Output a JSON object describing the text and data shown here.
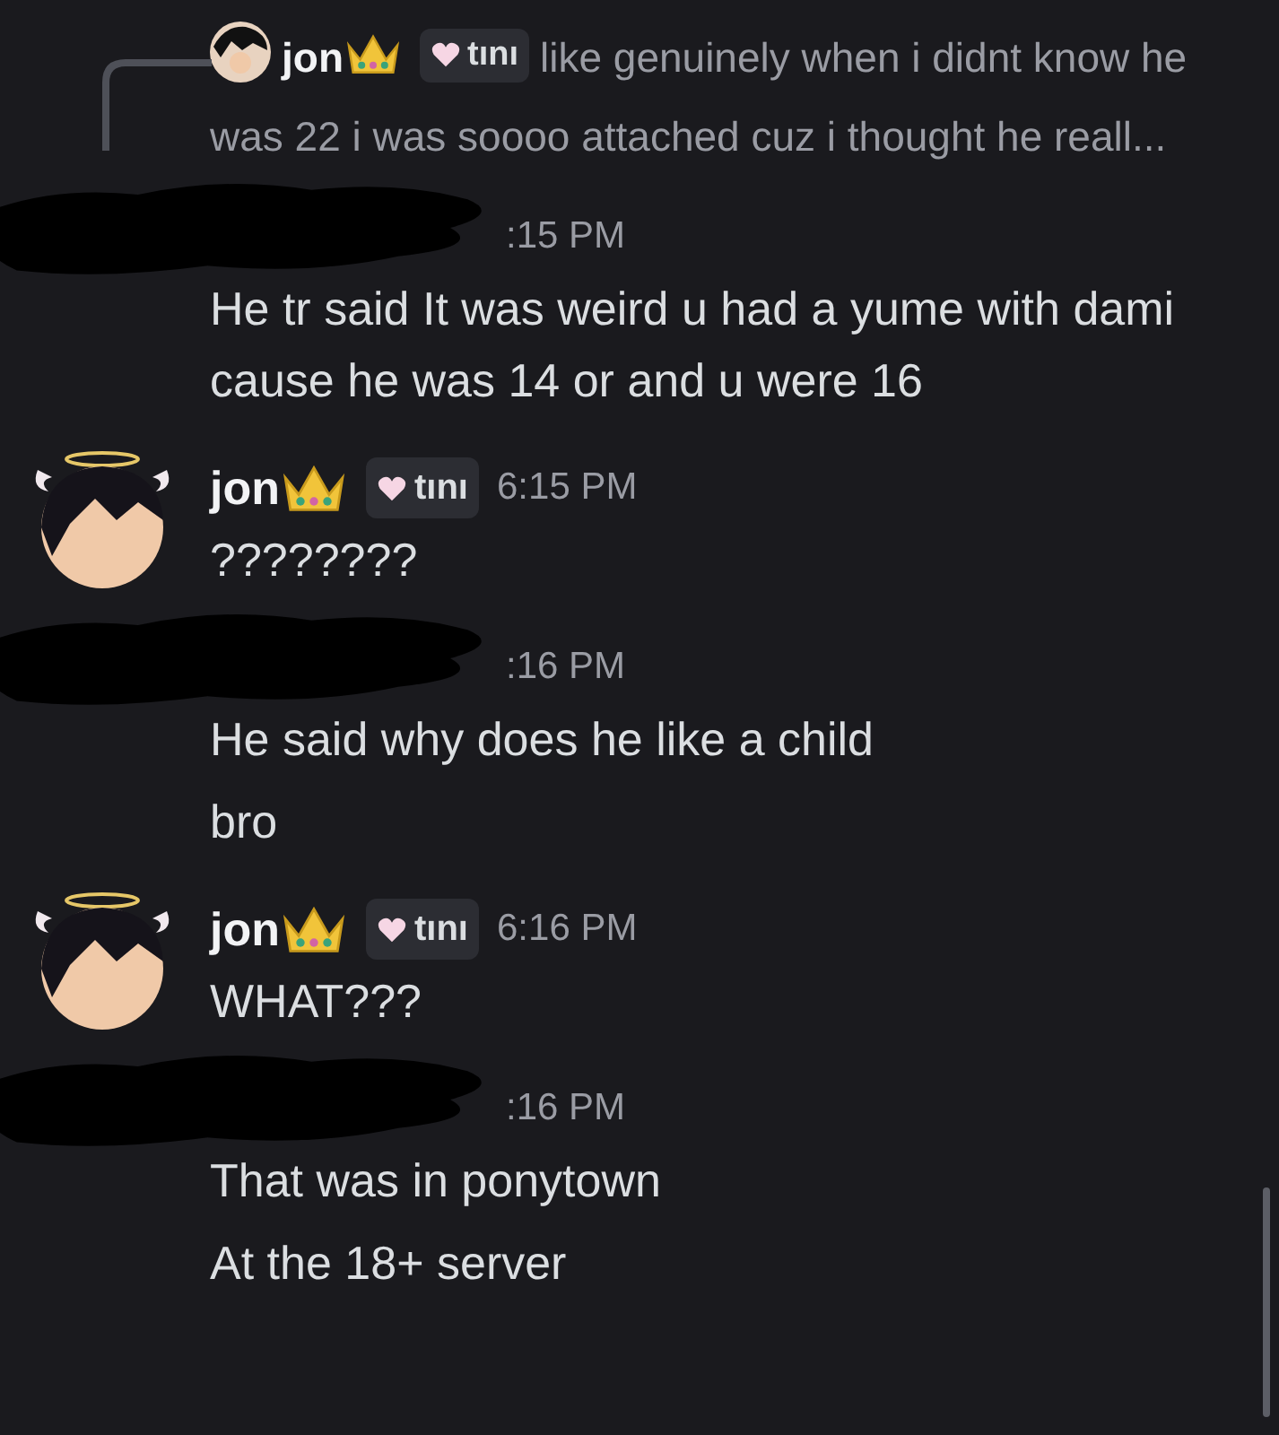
{
  "reply": {
    "author": "jon",
    "tag": "tını",
    "text_lines": [
      "like genuinely when i didnt know he",
      "was 22 i was soooo attached cuz i thought he reall..."
    ]
  },
  "messages": [
    {
      "kind": "redacted",
      "time": ":15 PM",
      "lines": [
        "He tr said It was weird u had a yume with dami cause he was 14 or and u were 16"
      ]
    },
    {
      "kind": "user",
      "author": "jon",
      "tag": "tını",
      "time": "6:15 PM",
      "lines": [
        "????????"
      ]
    },
    {
      "kind": "redacted",
      "time": ":16 PM",
      "lines": [
        "He said why does he like a child",
        "bro"
      ]
    },
    {
      "kind": "user",
      "author": "jon",
      "tag": "tını",
      "time": "6:16 PM",
      "lines": [
        "WHAT???"
      ]
    },
    {
      "kind": "redacted",
      "time": ":16 PM",
      "lines": [
        "That was in ponytown",
        "At the 18+ server"
      ]
    }
  ]
}
